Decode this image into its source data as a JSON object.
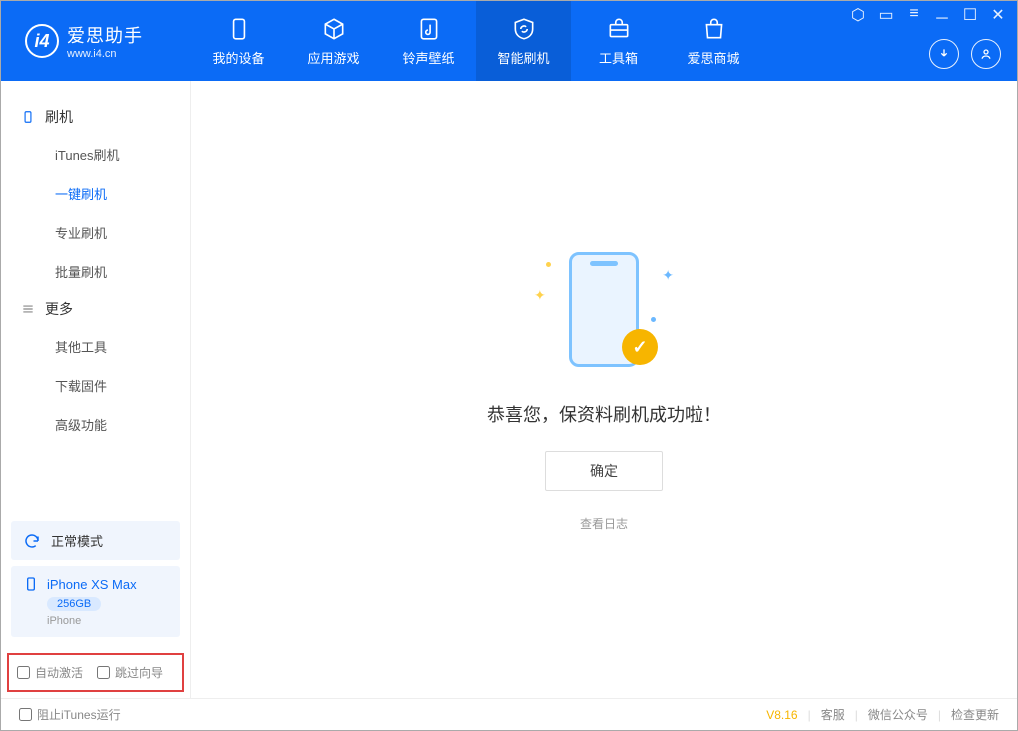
{
  "app": {
    "title": "爱思助手",
    "subtitle": "www.i4.cn"
  },
  "nav": {
    "tabs": [
      {
        "label": "我的设备"
      },
      {
        "label": "应用游戏"
      },
      {
        "label": "铃声壁纸"
      },
      {
        "label": "智能刷机"
      },
      {
        "label": "工具箱"
      },
      {
        "label": "爱思商城"
      }
    ]
  },
  "sidebar": {
    "group1": {
      "title": "刷机",
      "items": [
        "iTunes刷机",
        "一键刷机",
        "专业刷机",
        "批量刷机"
      ],
      "active_index": 1
    },
    "group2": {
      "title": "更多",
      "items": [
        "其他工具",
        "下载固件",
        "高级功能"
      ]
    }
  },
  "device": {
    "mode": "正常模式",
    "name": "iPhone XS Max",
    "storage": "256GB",
    "type": "iPhone"
  },
  "checkboxes": {
    "auto_activate": "自动激活",
    "skip_guide": "跳过向导"
  },
  "main": {
    "success_text": "恭喜您，保资料刷机成功啦！",
    "ok_button": "确定",
    "view_log": "查看日志"
  },
  "statusbar": {
    "block_itunes": "阻止iTunes运行",
    "version": "V8.16",
    "support": "客服",
    "wechat": "微信公众号",
    "check_update": "检查更新"
  }
}
